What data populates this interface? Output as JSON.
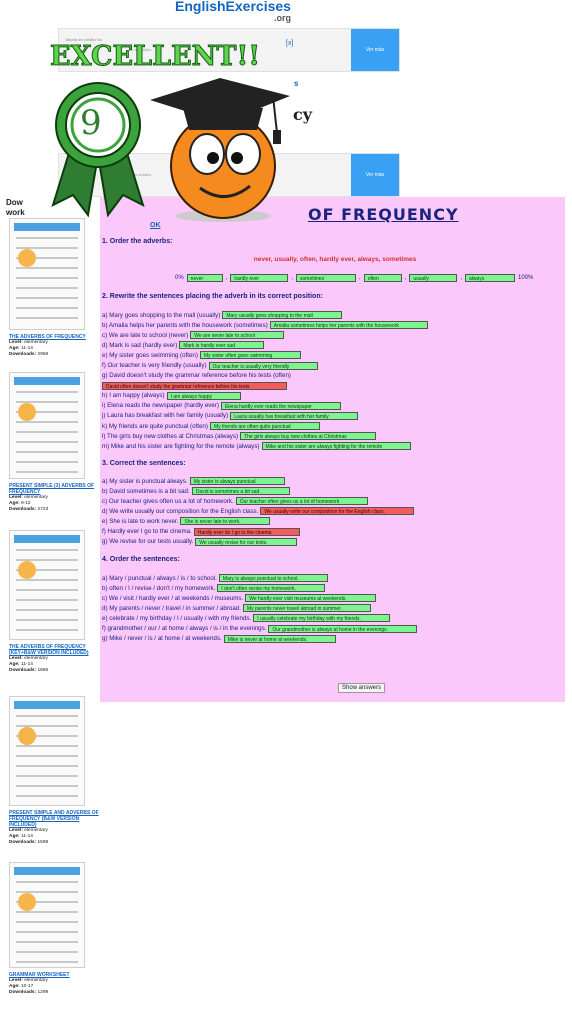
{
  "site": {
    "logo": "EnglishExercises",
    "logo_sub": ".org"
  },
  "ads": [
    {
      "text": "Tarjeta de crédito Nu",
      "small": "en tu bolsillo.",
      "button": "Ver más",
      "x": "[x]"
    },
    {
      "text": "",
      "small": "en tu bolsillo.",
      "button": "Ver más",
      "x": ""
    }
  ],
  "overlay": {
    "excellent": "EXCELLENT!!",
    "score": "9",
    "ok": "OK"
  },
  "page": {
    "title_fragment": "OF FREQUENCY",
    "cy": "cy",
    "s_frag": "s",
    "download_frag": "Dow",
    "work_frag": "work"
  },
  "sections": {
    "s1": {
      "heading": "1. Order the adverbs:",
      "adverbs": "never, usually, often, hardly ever, always, sometimes",
      "start": "0%",
      "end": "100%",
      "answers": [
        "never",
        "hardly ever",
        "sometimes",
        "often",
        "usually",
        "always"
      ]
    },
    "s2": {
      "heading": "2. Rewrite the sentences placing the adverb in its correct position:",
      "items": [
        {
          "q": "a) Mary goes shopping to the mall (usually)",
          "a": "Mary usually goes shopping to the mall",
          "ok": true
        },
        {
          "q": "b) Amalia helps her parents with the housework (sometimes)",
          "a": "Amalia sometimes helps her parents with the housework",
          "ok": true
        },
        {
          "q": "c) We are late to school (never)",
          "a": "We are never late to school",
          "ok": true
        },
        {
          "q": "d) Mark is sad (hardly ever)",
          "a": "Mark is hardly ever sad",
          "ok": true
        },
        {
          "q": "e) My sister goes swimming (often)",
          "a": "My sister often goes swimming",
          "ok": true
        },
        {
          "q": "f) Our teacher is very friendly (usually)",
          "a": "Our teacher is usually very friendly",
          "ok": true
        },
        {
          "q": "g) David doesn't study the grammar reference before his tests (often)",
          "a": "",
          "ok": true
        },
        {
          "q": "",
          "a": "David often doesn't study the grammar reference before his tests",
          "ok": false
        },
        {
          "q": "h) I am happy (always)",
          "a": "I am always happy",
          "ok": true
        },
        {
          "q": "i) Elena reads the newspaper (hardly ever)",
          "a": "Elena hardly ever reads the newspaper",
          "ok": true
        },
        {
          "q": "j) Laura has breakfast with her family (usually)",
          "a": "Laura usually has breakfast with her family",
          "ok": true
        },
        {
          "q": "k) My friends are quite punctual (often)",
          "a": "My friends are often quite punctual",
          "ok": true
        },
        {
          "q": "l) The girls buy new clothes at Christmas (always)",
          "a": "The girls always buy new clothes at Christmas",
          "ok": true
        },
        {
          "q": "m) Mike and his sister are fighting for the remote (always)",
          "a": "Mike and his sister are always fighting for the remote",
          "ok": true
        }
      ]
    },
    "s3": {
      "heading": "3. Correct the sentences:",
      "items": [
        {
          "q": "a) My sister is punctual always.",
          "a": "My sister is always punctual",
          "ok": true
        },
        {
          "q": "b) David sometimes is a bit sad.",
          "a": "David is sometimes a bit sad.",
          "ok": true
        },
        {
          "q": "c) Our teacher gives often us a lot of homework.",
          "a": "Our teacher often gives us a lot of homework",
          "ok": true
        },
        {
          "q": "d) We write usually our composition for the English class.",
          "a": "We usually write our composition for the English class.",
          "ok": false
        },
        {
          "q": "e) She is late to work never.",
          "a": "She is never late to work.",
          "ok": true
        },
        {
          "q": "f) Hardly ever I go to the cinema.",
          "a": "Hardly ever do I go to the cinema",
          "ok": false
        },
        {
          "q": "g) We revise for our tests usually.",
          "a": "We usually revise for our tests.",
          "ok": true
        }
      ]
    },
    "s4": {
      "heading": "4. Order the sentences:",
      "items": [
        {
          "q": "a) Mary / punctual / always / is / to school.",
          "a": "Mary is always punctual to school.",
          "ok": true
        },
        {
          "q": "b) often / I / revise / don't / my homework.",
          "a": "I don't often revise my homework.",
          "ok": true
        },
        {
          "q": "c) We / visit / hardly ever / at weekends / museums.",
          "a": "We hardly ever visit museums at weekends.",
          "ok": true
        },
        {
          "q": "d) My parents / never / travel / in summer / abroad.",
          "a": "My parents never travel abroad in summer.",
          "ok": true
        },
        {
          "q": "e) celebrate / my birthday / I / usually / with my friends.",
          "a": "I usually celebrate my birthday with my friends.",
          "ok": true
        },
        {
          "q": "f) grandmother / our / at home / always / is / in the evenings.",
          "a": "Our grandmother is always at home in the evenings.",
          "ok": true
        },
        {
          "q": "g) Mike / never / is / at home / at weekends.",
          "a": "Mike is never at home at weekends.",
          "ok": true
        }
      ]
    },
    "show_answers": "Show answers"
  },
  "sidebar": [
    {
      "title": "THE ADVERBS OF FREQUENCY",
      "level": "elementary",
      "age": "11-14",
      "downloads": "2968"
    },
    {
      "title": "PRESENT SIMPLE (3) ADVERBS OF FREQUENCY",
      "level": "elementary",
      "age": "9-12",
      "downloads": "2723"
    },
    {
      "title": "THE ADVERBS OF FREQUENCY (KEY+B&W VERSION INCLUDED)",
      "level": "elementary",
      "age": "11-14",
      "downloads": "1865"
    },
    {
      "title": "PRESENT SIMPLE AND ADVERBS OF FREQUENCY (B&W VERSION INCLUDED)",
      "level": "elementary",
      "age": "11-14",
      "downloads": "1598"
    },
    {
      "title": "GRAMMAR WORKSHEET",
      "level": "elementary",
      "age": "10-17",
      "downloads": "1299"
    }
  ],
  "meta_labels": {
    "level": "Level:",
    "age": "Age:",
    "downloads": "Downloads:"
  },
  "colors": {
    "correct": "#7df58f",
    "wrong": "#f25c5c",
    "panel": "#fbc8fb",
    "title": "#1a237e"
  }
}
